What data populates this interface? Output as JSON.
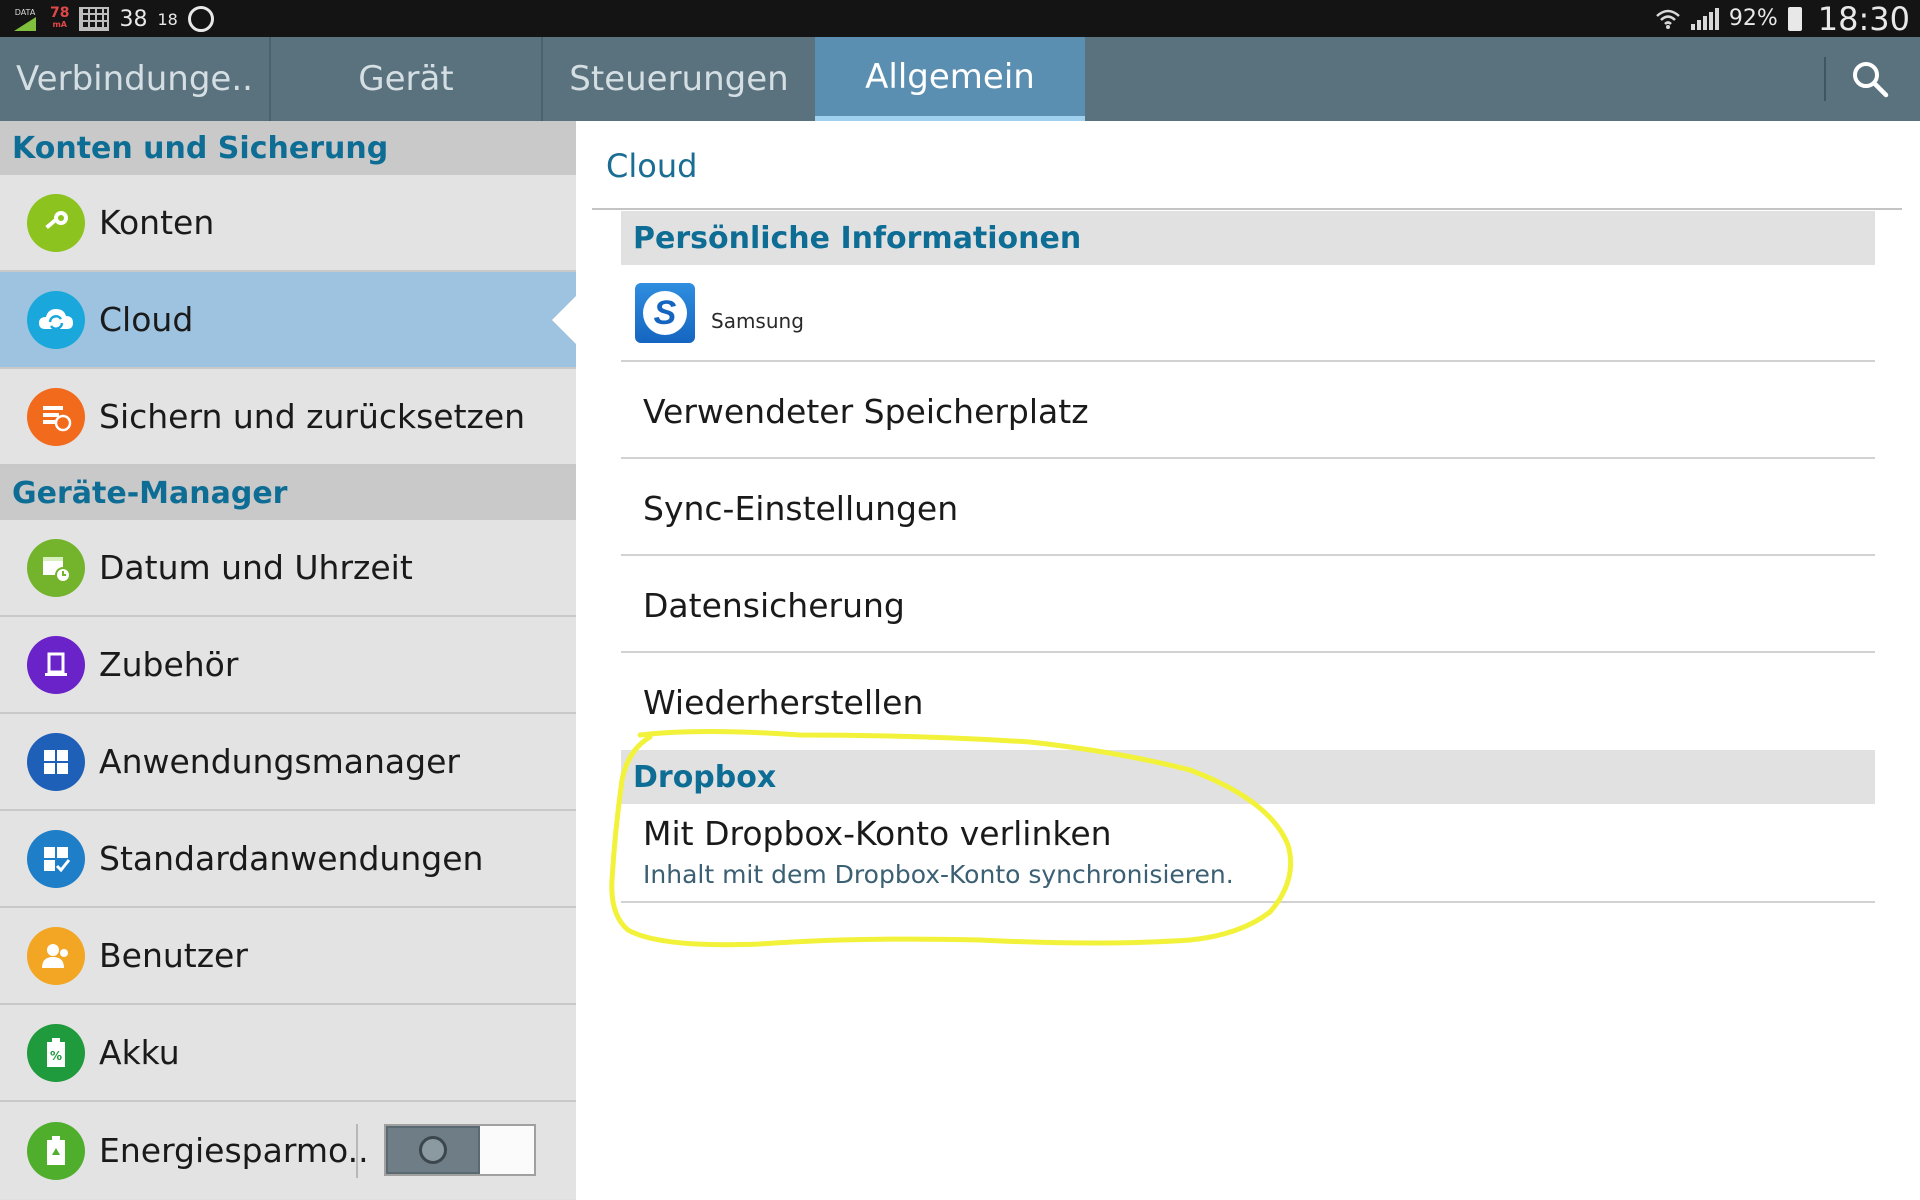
{
  "status_bar": {
    "data_label": "DATA",
    "ma_value": "78",
    "ma_unit": "mA",
    "temp_value": "38",
    "temp_value2": "18",
    "battery_percent": "92%",
    "time": "18:30"
  },
  "tabs": [
    {
      "label": "Verbindunge.."
    },
    {
      "label": "Gerät"
    },
    {
      "label": "Steuerungen"
    },
    {
      "label": "Allgemein",
      "active": true
    }
  ],
  "sidebar": {
    "sections": [
      {
        "header": "Konten und Sicherung",
        "items": [
          {
            "label": "Konten",
            "icon": "key-icon",
            "color": "#8dc31f"
          },
          {
            "label": "Cloud",
            "icon": "cloud-sync-icon",
            "color": "#1aa8dc",
            "active": true
          },
          {
            "label": "Sichern und zurücksetzen",
            "icon": "backup-icon",
            "color": "#f26a1b"
          }
        ]
      },
      {
        "header": "Geräte-Manager",
        "items": [
          {
            "label": "Datum und Uhrzeit",
            "icon": "calendar-clock-icon",
            "color": "#74b42c"
          },
          {
            "label": "Zubehör",
            "icon": "accessory-icon",
            "color": "#6a22c9"
          },
          {
            "label": "Anwendungsmanager",
            "icon": "app-grid-icon",
            "color": "#1e5fb7"
          },
          {
            "label": "Standardanwendungen",
            "icon": "default-apps-icon",
            "color": "#1e7ec8"
          },
          {
            "label": "Benutzer",
            "icon": "user-icon",
            "color": "#f2a623"
          },
          {
            "label": "Akku",
            "icon": "battery-icon",
            "color": "#1f9a3c"
          },
          {
            "label": "Energiesparmo..",
            "icon": "power-saving-icon",
            "color": "#4fae2c",
            "toggle": true
          }
        ]
      }
    ]
  },
  "content": {
    "title": "Cloud",
    "personal_header": "Persönliche Informationen",
    "samsung_account_label": "Samsung",
    "rows": [
      {
        "label": "Verwendeter Speicherplatz"
      },
      {
        "label": "Sync-Einstellungen"
      },
      {
        "label": "Datensicherung"
      },
      {
        "label": "Wiederherstellen"
      }
    ],
    "dropbox_header": "Dropbox",
    "dropbox_link_label": "Mit Dropbox-Konto verlinken",
    "dropbox_link_sub": "Inhalt mit dem Dropbox-Konto synchronisieren."
  },
  "colors": {
    "accent": "#0d6d95",
    "tabbar": "#59727e",
    "active_tab": "#5b8fb1",
    "annotation": "#f2f23a"
  }
}
